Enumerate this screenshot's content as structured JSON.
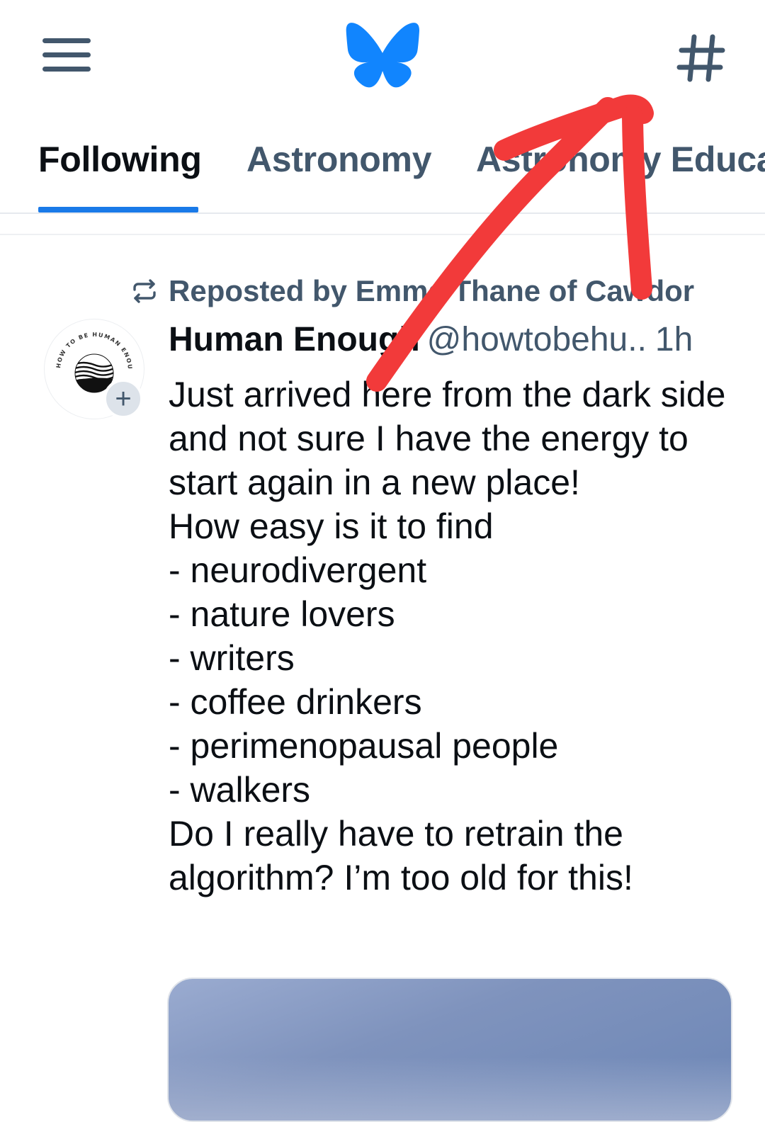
{
  "header": {
    "menu_icon": "hamburger-menu-icon",
    "logo_icon": "butterfly-logo",
    "feeds_icon": "hashtag-icon",
    "colors": {
      "brand_blue": "#1185fe",
      "icon_gray": "#42576c"
    }
  },
  "tabs": [
    {
      "label": "Following",
      "active": true
    },
    {
      "label": "Astronomy",
      "active": false
    },
    {
      "label": "Astronomy Educa",
      "active": false
    }
  ],
  "post": {
    "repost_label": "Reposted by Emma Thane of Cawdor",
    "author_name": "Human Enough",
    "author_handle": "@howtobehu..",
    "time": "1h",
    "avatar_text": "HOW TO BE HUMAN ENOUGH",
    "text": "Just arrived here from the dark side and not sure I have the energy to start again in a new place!\nHow easy is it to find\n- neurodivergent\n- nature lovers\n- writers\n- coffee drinkers\n- perimenopausal people\n- walkers\nDo I really have to retrain the algorithm? I’m too old for this!",
    "follow_icon": "plus-icon"
  },
  "annotation": {
    "color": "#f23a3a",
    "icon": "red-arrow-annotation"
  }
}
